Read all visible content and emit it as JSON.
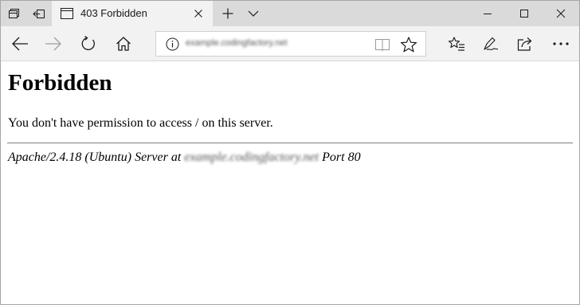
{
  "tab": {
    "title": "403 Forbidden"
  },
  "address": {
    "url": "example.codingfactory.net"
  },
  "page": {
    "heading": "Forbidden",
    "message": "You don't have permission to access / on this server.",
    "signature_prefix": "Apache/2.4.18 (Ubuntu) Server at",
    "signature_host": "example.codingfactory.net",
    "signature_suffix": "Port 80"
  },
  "icons": {
    "set_aside_tabs": "tabs-set-aside-icon",
    "restore_tabs": "tabs-restore-icon",
    "tab_page": "page-icon",
    "tab_close": "close-icon",
    "new_tab": "plus-icon",
    "tab_list": "chevron-down-icon",
    "minimize": "minimize-icon",
    "maximize": "maximize-icon",
    "close_window": "close-icon",
    "back": "back-arrow-icon",
    "forward": "forward-arrow-icon",
    "refresh": "refresh-icon",
    "home": "home-icon",
    "site_info": "info-icon",
    "reading_view": "book-icon",
    "favorite": "star-icon",
    "favorites_hub": "hub-icon",
    "notes": "pen-icon",
    "share": "share-icon",
    "more": "more-icon"
  },
  "colors": {
    "titlebar": "#dadada",
    "toolbar": "#f2f2f2",
    "icon": "#1a1a1a",
    "icon_disabled": "#a0a0a0"
  }
}
